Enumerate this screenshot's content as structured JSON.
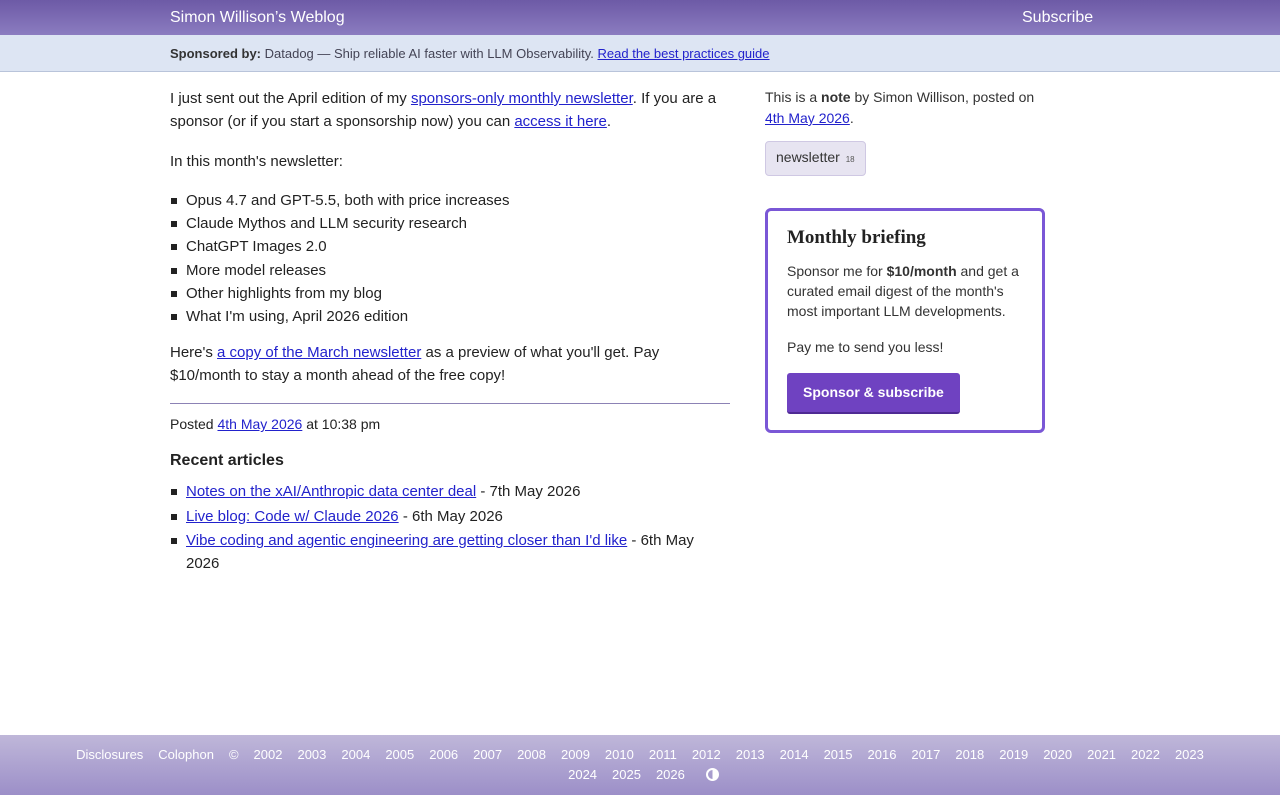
{
  "header": {
    "site_title": "Simon Willison’s Weblog",
    "subscribe": "Subscribe"
  },
  "sponsor": {
    "label": "Sponsored by:",
    "text": "Datadog — Ship reliable AI faster with LLM Observability.",
    "link": "Read the best practices guide"
  },
  "post": {
    "p1_a": "I just sent out the April edition of my ",
    "p1_link1": "sponsors-only monthly newsletter",
    "p1_b": ". If you are a sponsor (or if you start a sponsorship now) you can ",
    "p1_link2": "access it here",
    "p1_c": ".",
    "p2": "In this month's newsletter:",
    "items": [
      "Opus 4.7 and GPT-5.5, both with price increases",
      "Claude Mythos and LLM security research",
      "ChatGPT Images 2.0",
      "More model releases",
      "Other highlights from my blog",
      "What I'm using, April 2026 edition"
    ],
    "p3_a": "Here's ",
    "p3_link": "a copy of the March newsletter",
    "p3_b": " as a preview of what you'll get. Pay $10/month to stay a month ahead of the free copy!",
    "posted_label": "Posted ",
    "posted_date": "4th May 2026",
    "posted_time": " at 10:38 pm"
  },
  "recent": {
    "title": "Recent articles",
    "items": [
      {
        "title": "Notes on the xAI/Anthropic data center deal",
        "date": " - 7th May 2026"
      },
      {
        "title": "Live blog: Code w/ Claude 2026",
        "date": " - 6th May 2026"
      },
      {
        "title": "Vibe coding and agentic engineering are getting closer than I'd like",
        "date": " - 6th May 2026"
      }
    ]
  },
  "sidebar": {
    "note_a": "This is a ",
    "note_b": "note",
    "note_c": " by Simon Willison, posted on ",
    "note_date": "4th May 2026",
    "note_d": ".",
    "tag_name": "newsletter",
    "tag_count": "18",
    "briefing": {
      "title": "Monthly briefing",
      "text_a": "Sponsor me for ",
      "text_b": "$10/month",
      "text_c": " and get a curated email digest of the month's most important LLM developments.",
      "pay": "Pay me to send you less!",
      "button": "Sponsor & subscribe"
    }
  },
  "footer": {
    "disclosures": "Disclosures",
    "colophon": "Colophon",
    "copyright": "©",
    "years_row1": [
      "2002",
      "2003",
      "2004",
      "2005",
      "2006",
      "2007",
      "2008",
      "2009",
      "2010",
      "2011",
      "2012",
      "2013",
      "2014",
      "2015",
      "2016",
      "2017",
      "2018",
      "2019",
      "2020",
      "2021",
      "2022",
      "2023"
    ],
    "years_row2": [
      "2024",
      "2025",
      "2026"
    ]
  }
}
